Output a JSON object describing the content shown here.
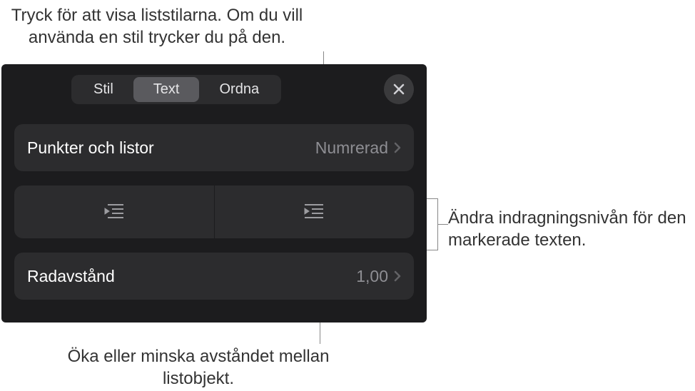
{
  "callouts": {
    "top": "Tryck för att visa liststilarna. Om du vill använda en stil trycker du på den.",
    "right": "Ändra indragningsnivån för den markerade texten.",
    "bottom": "Öka eller minska avståndet mellan listobjekt."
  },
  "tabs": {
    "style": "Stil",
    "text": "Text",
    "arrange": "Ordna"
  },
  "rows": {
    "bullets_label": "Punkter och listor",
    "bullets_value": "Numrerad",
    "line_spacing_label": "Radavstånd",
    "line_spacing_value": "1,00"
  }
}
